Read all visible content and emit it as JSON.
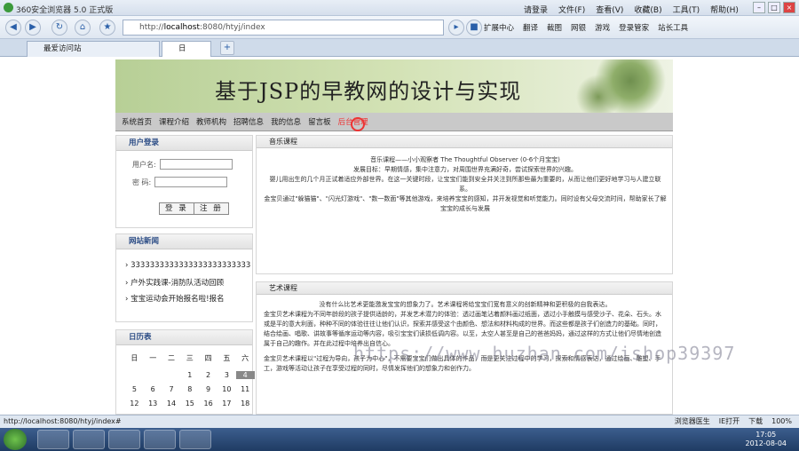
{
  "browser": {
    "title": "360安全浏览器 5.0 正式版",
    "menu": [
      "文件(F)",
      "查看(V)",
      "收藏(B)",
      "工具(T)",
      "帮助(H)"
    ],
    "login": "请登录",
    "address_prefix": "http://",
    "address_host": "localhost",
    "address_rest": ":8080/htyj/index",
    "toolbar_items": [
      "扩展中心",
      "翻译",
      "截图",
      "网银",
      "游戏",
      "登录管家",
      "站长工具"
    ],
    "tabs": [
      "最爱访问站",
      "日"
    ]
  },
  "site": {
    "banner_title": "基于JSP的早教网的设计与实现",
    "nav": [
      "系统首页",
      "课程介绍",
      "教师机构",
      "招聘信息",
      "我的信息",
      "留言板",
      "后台管理"
    ],
    "login_panel": {
      "title": "用户登录",
      "username_label": "用户名:",
      "password_label": "密  码:",
      "login_btn": "登 录",
      "register_btn": "注 册"
    },
    "news_panel": {
      "title": "网站新闻",
      "items": [
        "3333333333333333333333333",
        "户外实践课-消防队活动回顾",
        "宝宝运动会开始报名啦!报名"
      ]
    },
    "calendar_panel": {
      "title": "日历表",
      "weekdays": [
        "日",
        "一",
        "二",
        "三",
        "四",
        "五",
        "六"
      ],
      "rows": [
        [
          "",
          "",
          "",
          "1",
          "2",
          "3",
          "4"
        ],
        [
          "5",
          "6",
          "7",
          "8",
          "9",
          "10",
          "11"
        ],
        [
          "12",
          "13",
          "14",
          "15",
          "16",
          "17",
          "18"
        ]
      ],
      "today": "4"
    },
    "music_panel": {
      "title": "音乐课程",
      "lines": [
        "音乐课程——小小观察者  The Thoughtful Observer (0-6个月宝宝)",
        "发展目标：早期情感，集中注意力，对周围世界充满好奇，尝试探索世界的兴趣。",
        "婴儿用出生的几个月正试着适应外部世界。在这一关键时段，让宝宝们能到安全并关注到所那些最为重要的，从而让他们更好地学习与人建立联系。",
        "金宝贝通过\"躲猫猫\"、\"闪光灯游戏\"、\"数一数面\"等其他游戏，来培养宝宝的感知，并开发视觉和听觉能力。同时设有父母交流时间，帮助家长了解宝宝的成长与发展"
      ]
    },
    "art_panel": {
      "title": "艺术课程",
      "lines": [
        "没有什么比艺术更能激发宝宝的想象力了。艺术课程将给宝宝们宽有意义的创新精神和更积极的自我表达。",
        "金宝贝艺术课程为不同年龄段的孩子提供适龄的，并发艺术潜力的体验：透过画笔沾着颜料画过纸面，透过小手触摸与感受沙子、花朵、石头。水或是平的意大利面，种种不同的体验往往让他们认识，探索并感受这个由颜色、想法和材料构成的世界。而这些都是孩子们创造力的基础。同时，结合绘画、唱歌、讲故事等循序运动等内容，吸引宝宝们读损低调内容。以至，太空人甚至是自己的爸爸妈妈，通过这样的方式让他们尽情地创造属于自己的趣作。并在此过程中培养出自信心。",
        "金宝贝艺术课程以\"过程为导向，孩子为中心\"，不需要宝宝们做出具体的作品，而是更关注过程中的学习，探索和情感表达，通过绘画、雕塑、手工，游戏等活动让孩子在享受过程的同时，尽情发挥他们的想象力和创作力。"
      ]
    }
  },
  "watermark": "https://www.huzhan.com/ishop39397",
  "status": {
    "url": "http://localhost:8080/htyj/index#",
    "items": [
      "浏览器医生",
      "IE打开",
      "下载",
      "100%"
    ]
  },
  "clock": {
    "time": "17:05",
    "date": "2012-08-04"
  }
}
